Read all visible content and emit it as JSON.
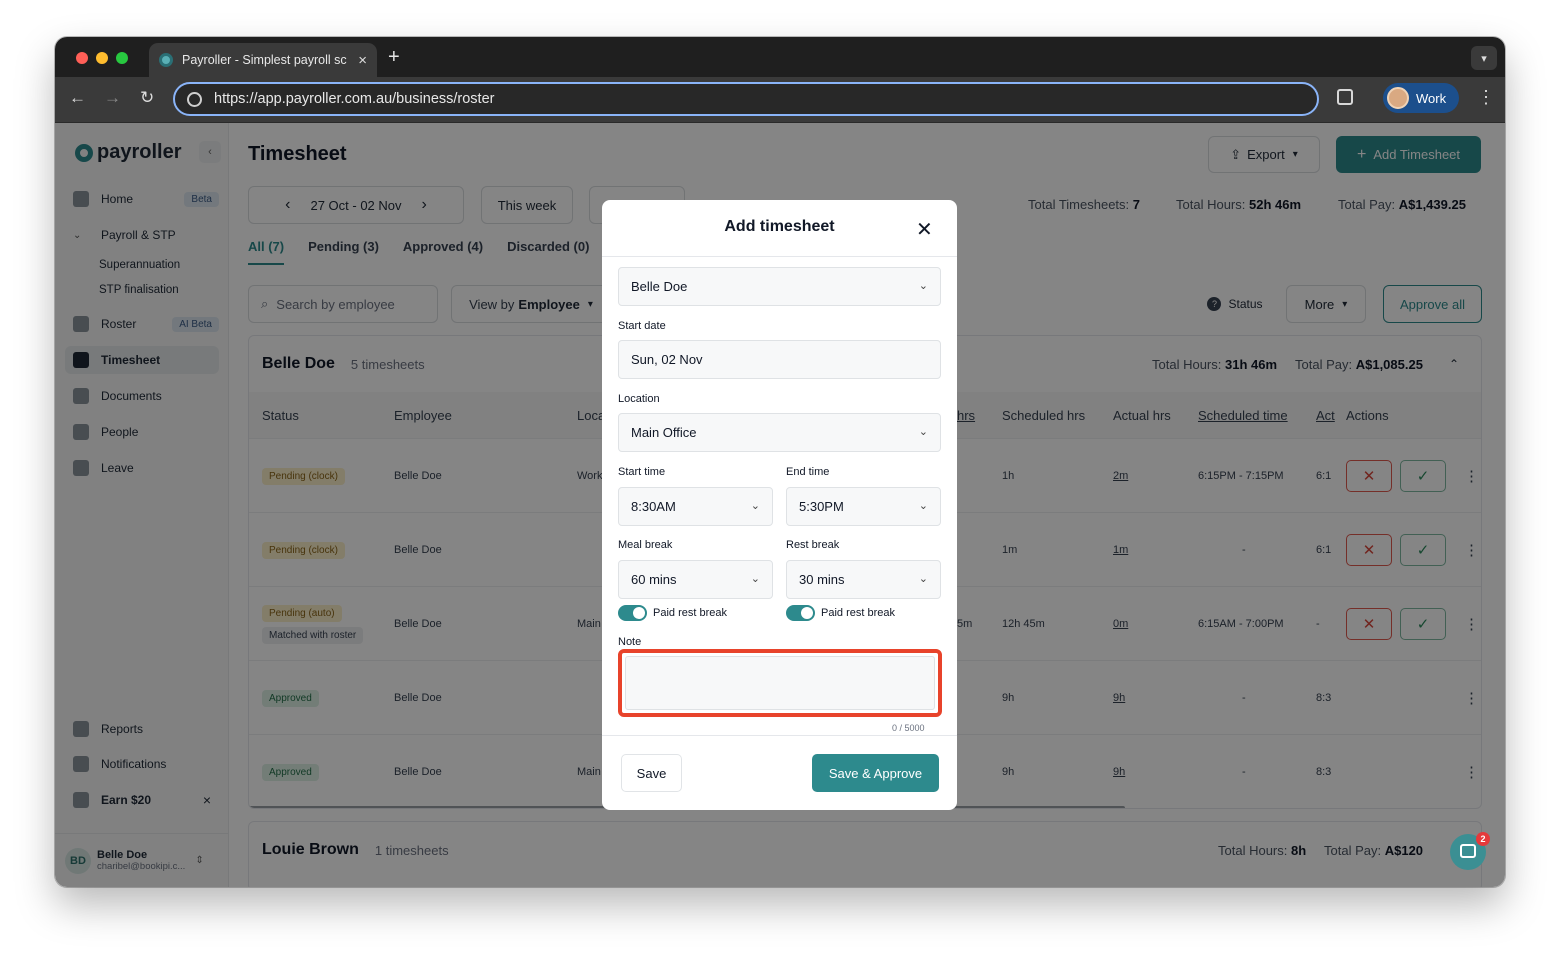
{
  "browser": {
    "tab_title": "Payroller - Simplest payroll sc",
    "url": "https://app.payroller.com.au/business/roster",
    "profile_label": "Work"
  },
  "sidebar": {
    "brand": "payroller",
    "items": [
      {
        "label": "Home",
        "badge": "Beta"
      },
      {
        "label": "Payroll & STP"
      },
      {
        "label": "Superannuation"
      },
      {
        "label": "STP finalisation"
      },
      {
        "label": "Roster",
        "badge": "AI Beta"
      },
      {
        "label": "Timesheet"
      },
      {
        "label": "Documents"
      },
      {
        "label": "People"
      },
      {
        "label": "Leave"
      }
    ],
    "bottom_items": [
      {
        "label": "Reports"
      },
      {
        "label": "Notifications"
      },
      {
        "label": "Earn $20"
      }
    ],
    "user": {
      "initials": "BD",
      "name": "Belle Doe",
      "email": "charibel@bookipi.c..."
    }
  },
  "page": {
    "title": "Timesheet",
    "export_label": "Export",
    "add_label": "Add Timesheet",
    "date_range": "27 Oct - 02 Nov",
    "this_week": "This week",
    "stats": {
      "ts_label": "Total Timesheets:",
      "ts_value": "7",
      "hrs_label": "Total Hours:",
      "hrs_value": "52h 46m",
      "pay_label": "Total Pay:",
      "pay_value": "A$1,439.25"
    },
    "tabs": [
      "All (7)",
      "Pending (3)",
      "Approved (4)",
      "Discarded (0)"
    ],
    "search_placeholder": "Search by employee",
    "view_by_prefix": "View by",
    "view_by_value": "Employee",
    "status_label": "Status",
    "more_label": "More",
    "approve_all": "Approve all"
  },
  "groups": [
    {
      "name": "Belle Doe",
      "count": "5 timesheets",
      "hrs_label": "Total Hours:",
      "hrs": "31h 46m",
      "pay_label": "Total Pay:",
      "pay": "A$1,085.25",
      "columns": [
        "Status",
        "Employee",
        "Loca",
        "hrs",
        "Scheduled hrs",
        "Actual hrs",
        "Scheduled time",
        "Act",
        "Actions"
      ],
      "rows": [
        {
          "status": "Pending (clock)",
          "employee": "Belle Doe",
          "loc": "Work",
          "sched_hrs": "1h",
          "actual": "2m",
          "sched_time": "6:15PM - 7:15PM",
          "act": "6:1"
        },
        {
          "status": "Pending (clock)",
          "employee": "Belle Doe",
          "loc": "",
          "sched_hrs": "1m",
          "actual": "1m",
          "sched_time": "-",
          "act": "6:1"
        },
        {
          "status": "Pending (auto)",
          "extra": "Matched with roster",
          "employee": "Belle Doe",
          "loc": "Main",
          "brk": "5m",
          "sched_hrs": "12h 45m",
          "actual": "0m",
          "sched_time": "6:15AM - 7:00PM",
          "act": "-"
        },
        {
          "status": "Approved",
          "employee": "Belle Doe",
          "loc": "",
          "sched_hrs": "9h",
          "actual": "9h",
          "sched_time": "-",
          "act": "8:3"
        },
        {
          "status": "Approved",
          "employee": "Belle Doe",
          "loc": "Main",
          "sched_hrs": "9h",
          "actual": "9h",
          "sched_time": "-",
          "act": "8:3"
        }
      ]
    },
    {
      "name": "Louie Brown",
      "count": "1 timesheets",
      "hrs_label": "Total Hours:",
      "hrs": "8h",
      "pay_label": "Total Pay:",
      "pay": "A$120"
    }
  ],
  "modal": {
    "title": "Add timesheet",
    "employee_value": "Belle Doe",
    "start_date_label": "Start date",
    "start_date_value": "Sun, 02 Nov",
    "location_label": "Location",
    "location_value": "Main Office",
    "start_time_label": "Start time",
    "start_time_value": "8:30AM",
    "end_time_label": "End time",
    "end_time_value": "5:30PM",
    "meal_label": "Meal break",
    "meal_value": "60 mins",
    "rest_label": "Rest break",
    "rest_value": "30 mins",
    "paid_rest_1": "Paid rest break",
    "paid_rest_2": "Paid rest break",
    "note_label": "Note",
    "note_value": "",
    "note_counter": "0 / 5000",
    "save_label": "Save",
    "approve_label": "Save & Approve"
  },
  "chat_badge": "2",
  "colors": {
    "accent": "#2d8a8d",
    "highlight": "#e8432b"
  }
}
